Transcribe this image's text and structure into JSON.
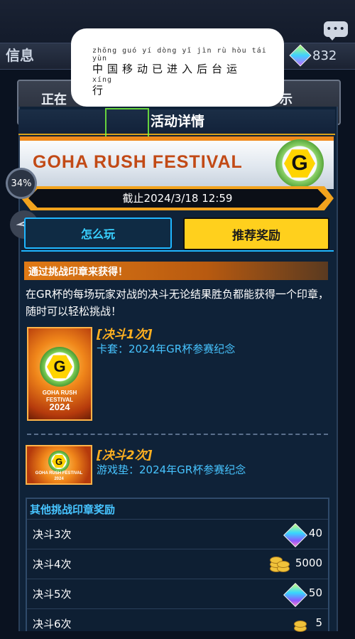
{
  "background": {
    "title": "信息",
    "gem_count": "832",
    "panel_text_left": "正在",
    "panel_text_right": "示",
    "percent": "34%"
  },
  "bubble": {
    "pinyin": "zhōng guó  yí dòng yǐ  jìn  rù hòu tái yùn",
    "hanzi": "中国移动已进入后台运",
    "pinyin2": "xíng",
    "hanzi2": "行"
  },
  "dialog": {
    "title": "活动详情",
    "banner_title": "GOHA RUSH FESTIVAL",
    "deadline": "截止2024/3/18 12:59",
    "tabs": [
      {
        "label": "怎么玩",
        "active": false
      },
      {
        "label": "推荐奖励",
        "active": true
      }
    ],
    "section_title": "通过挑战印章来获得！",
    "description": "在GR杯的每场玩家对战的决斗无论结果胜负都能获得一个印章，随时可以轻松挑战！",
    "rewards": [
      {
        "title": "[决斗1次]",
        "desc": "卡套：2024年GR杯参赛纪念",
        "art_caption": "GOHA RUSH FESTIVAL",
        "art_year": "2024"
      },
      {
        "title": "[决斗2次]",
        "desc": "游戏垫：2024年GR杯参赛纪念",
        "art_caption": "GOHA RUSH FESTIVAL",
        "art_year": "2024"
      }
    ],
    "other_title": "其他挑战印章奖励",
    "other_rows": [
      {
        "label": "决斗3次",
        "icon": "gem-icon",
        "value": "40"
      },
      {
        "label": "决斗4次",
        "icon": "gold-coins-icon",
        "value": "5000"
      },
      {
        "label": "决斗5次",
        "icon": "gem-icon",
        "value": "50"
      },
      {
        "label": "决斗6次",
        "icon": "gold-coins-icon",
        "value": "5"
      }
    ]
  },
  "colors": {
    "accent_orange": "#f2a31d",
    "tab_active": "#ffd01d",
    "tab_inactive_text": "#39d0ff",
    "reward_title": "#ffb020",
    "reward_desc": "#47c4ff"
  }
}
